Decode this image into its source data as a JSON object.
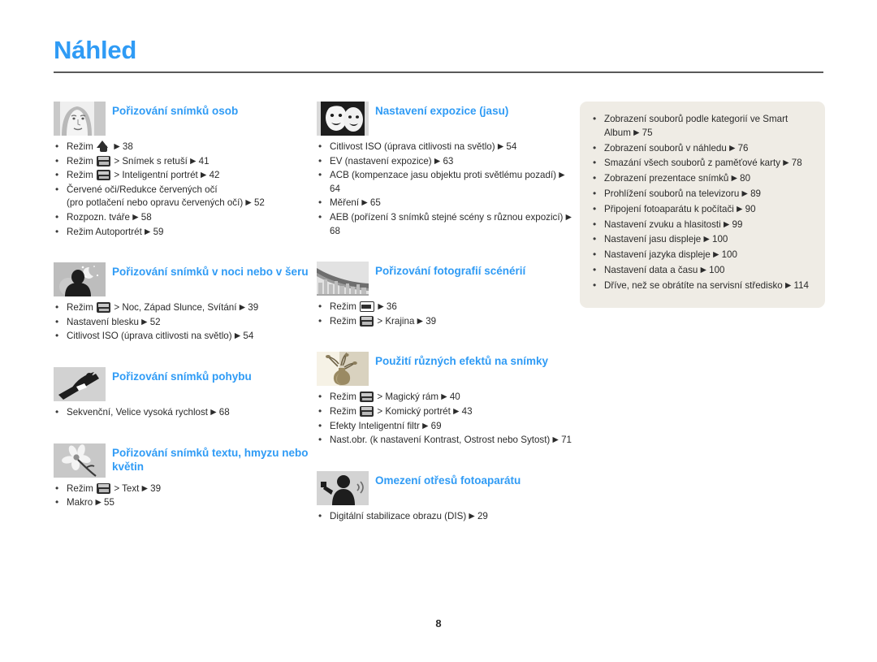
{
  "page": {
    "title": "Náhled",
    "folio": "8",
    "accent_color": "#2f9bf5",
    "panel_color": "#efece5",
    "rule_color": "#5a5a5a"
  },
  "columns": {
    "left": [
      {
        "id": "portraits",
        "thumb_icon": "woman-portrait-thumb",
        "title": "Pořizování snímků osob",
        "items": [
          {
            "pre": "Režim",
            "icon": "smart-auto-mode-icon",
            "post": "",
            "arrow": "▶",
            "page": "38"
          },
          {
            "pre": "Režim",
            "icon": "scene-mode-icon",
            "post": "> Snímek s retuší",
            "arrow": "▶",
            "page": "41"
          },
          {
            "pre": "Režim",
            "icon": "scene-mode-icon",
            "post": "> Inteligentní portrét",
            "arrow": "▶",
            "page": "42"
          },
          {
            "pre": "Červené oči/Redukce červených očí\n(pro potlačení nebo opravu červených očí)",
            "icon": "",
            "post": "",
            "arrow": "▶",
            "page": "52"
          },
          {
            "pre": "Rozpozn. tváře",
            "icon": "",
            "post": "",
            "arrow": "▶",
            "page": "58"
          },
          {
            "pre": "Režim Autoportrét",
            "icon": "",
            "post": "",
            "arrow": "▶",
            "page": "59"
          }
        ]
      },
      {
        "id": "night",
        "thumb_icon": "night-silhouette-thumb",
        "title": "Pořizování snímků v noci nebo v šeru",
        "items": [
          {
            "pre": "Režim",
            "icon": "scene-mode-icon",
            "post": "> Noc, Západ Slunce, Svítání",
            "arrow": "▶",
            "page": "39"
          },
          {
            "pre": "Nastavení blesku",
            "icon": "",
            "post": "",
            "arrow": "▶",
            "page": "52"
          },
          {
            "pre": "Citlivost ISO (úprava citlivosti na světlo)",
            "icon": "",
            "post": "",
            "arrow": "▶",
            "page": "54"
          }
        ]
      },
      {
        "id": "motion",
        "thumb_icon": "snowboarder-thumb",
        "title": "Pořizování snímků pohybu",
        "items": [
          {
            "pre": "Sekvenční, Velice vysoká rychlost",
            "icon": "",
            "post": "",
            "arrow": "▶",
            "page": "68"
          }
        ]
      },
      {
        "id": "macro",
        "thumb_icon": "flower-thumb",
        "title": "Pořizování snímků textu, hmyzu nebo květin",
        "items": [
          {
            "pre": "Režim",
            "icon": "scene-mode-icon",
            "post": "> Text",
            "arrow": "▶",
            "page": "39"
          },
          {
            "pre": "Makro",
            "icon": "",
            "post": "",
            "arrow": "▶",
            "page": "55"
          }
        ]
      }
    ],
    "middle": [
      {
        "id": "exposure",
        "thumb_icon": "two-faces-thumb",
        "title": "Nastavení expozice (jasu)",
        "items": [
          {
            "pre": "Citlivost ISO (úprava citlivosti na světlo)",
            "icon": "",
            "post": "",
            "arrow": "▶",
            "page": "54"
          },
          {
            "pre": "EV (nastavení expozice)",
            "icon": "",
            "post": "",
            "arrow": "▶",
            "page": "63"
          },
          {
            "pre": "ACB (kompenzace jasu objektu proti světlému pozadí)",
            "icon": "",
            "post": "",
            "arrow": "▶",
            "page": "64"
          },
          {
            "pre": "Měření",
            "icon": "",
            "post": "",
            "arrow": "▶",
            "page": "65"
          },
          {
            "pre": "AEB (pořízení 3 snímků stejné scény s různou expozicí)",
            "icon": "",
            "post": "",
            "arrow": "▶",
            "page": "68"
          }
        ]
      },
      {
        "id": "scenery",
        "thumb_icon": "bridge-cityscape-thumb",
        "title": "Pořizování fotografií scénérií",
        "items": [
          {
            "pre": "Režim",
            "icon": "auto-mode-icon",
            "post": "",
            "arrow": "▶",
            "page": "36"
          },
          {
            "pre": "Režim",
            "icon": "scene-mode-icon",
            "post": "> Krajina",
            "arrow": "▶",
            "page": "39"
          }
        ]
      },
      {
        "id": "effects",
        "thumb_icon": "sepia-vase-thumb",
        "title": "Použití různých efektů na snímky",
        "items": [
          {
            "pre": "Režim",
            "icon": "scene-mode-icon",
            "post": "> Magický rám",
            "arrow": "▶",
            "page": "40"
          },
          {
            "pre": "Režim",
            "icon": "scene-mode-icon",
            "post": "> Komický portrét",
            "arrow": "▶",
            "page": "43"
          },
          {
            "pre": "Efekty Inteligentní filtr",
            "icon": "",
            "post": "",
            "arrow": "▶",
            "page": "69"
          },
          {
            "pre": "Nast.obr. (k nastavení Kontrast, Ostrost nebo Sytost)",
            "icon": "",
            "post": "",
            "arrow": "▶",
            "page": "71"
          }
        ]
      },
      {
        "id": "shake",
        "thumb_icon": "shaking-person-thumb",
        "title": "Omezení otřesů fotoaparátu",
        "items": [
          {
            "pre": "Digitální stabilizace obrazu (DIS)",
            "icon": "",
            "post": "",
            "arrow": "▶",
            "page": "29"
          }
        ]
      }
    ],
    "right_panel": {
      "items": [
        {
          "pre": "Zobrazení souborů podle kategorií ve Smart Album",
          "arrow": "▶",
          "page": "75"
        },
        {
          "pre": "Zobrazení souborů v náhledu",
          "arrow": "▶",
          "page": "76"
        },
        {
          "pre": "Smazání všech souborů z paměťové karty",
          "arrow": "▶",
          "page": "78"
        },
        {
          "pre": "Zobrazení prezentace snímků",
          "arrow": "▶",
          "page": "80"
        },
        {
          "pre": "Prohlížení souborů na televizoru",
          "arrow": "▶",
          "page": "89"
        },
        {
          "pre": "Připojení fotoaparátu k počítači",
          "arrow": "▶",
          "page": "90"
        },
        {
          "pre": "Nastavení zvuku a hlasitosti",
          "arrow": "▶",
          "page": "99"
        },
        {
          "pre": "Nastavení jasu displeje",
          "arrow": "▶",
          "page": "100"
        },
        {
          "pre": "Nastavení jazyka displeje",
          "arrow": "▶",
          "page": "100"
        },
        {
          "pre": "Nastavení data a času",
          "arrow": "▶",
          "page": "100"
        },
        {
          "pre": "Dříve, než se obrátíte na servisní středisko",
          "arrow": "▶",
          "page": "114"
        }
      ]
    }
  }
}
